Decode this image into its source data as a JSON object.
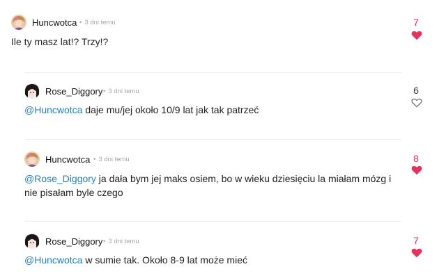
{
  "colors": {
    "liked": "#e8305c",
    "neutral": "#6f6f6f",
    "mention": "#1f82b8",
    "meta": "#a6a6a6"
  },
  "comments": [
    {
      "author": "Huncwotca",
      "separator": "•",
      "time": "3 dni temu",
      "mention": "",
      "text": "Ile ty masz lat!? Trzy!?",
      "votes": "7",
      "liked": true,
      "avatar_icon": "user-avatar-huncwotca"
    },
    {
      "author": "Rose_Diggory",
      "separator": "•",
      "time": "3 dni temu",
      "mention": "@Huncwotca",
      "text": " daje mu/jej około 10/9 lat jak tak patrzeć",
      "votes": "6",
      "liked": false,
      "avatar_icon": "user-avatar-rose"
    },
    {
      "author": "Huncwotca",
      "separator": "•",
      "time": "3 dni temu",
      "mention": "@Rose_Diggory",
      "text": " ja dała bym jej maks osiem, bo w wieku dziesięciu la miałam mózg i nie pisałam byle czego",
      "votes": "8",
      "liked": true,
      "avatar_icon": "user-avatar-huncwotca"
    },
    {
      "author": "Rose_Diggory",
      "separator": "•",
      "time": "3 dni temu",
      "mention": "@Huncwotca",
      "text": " w sumie tak. Około 8-9 lat może mieć",
      "votes": "7",
      "liked": true,
      "avatar_icon": "user-avatar-rose"
    }
  ]
}
